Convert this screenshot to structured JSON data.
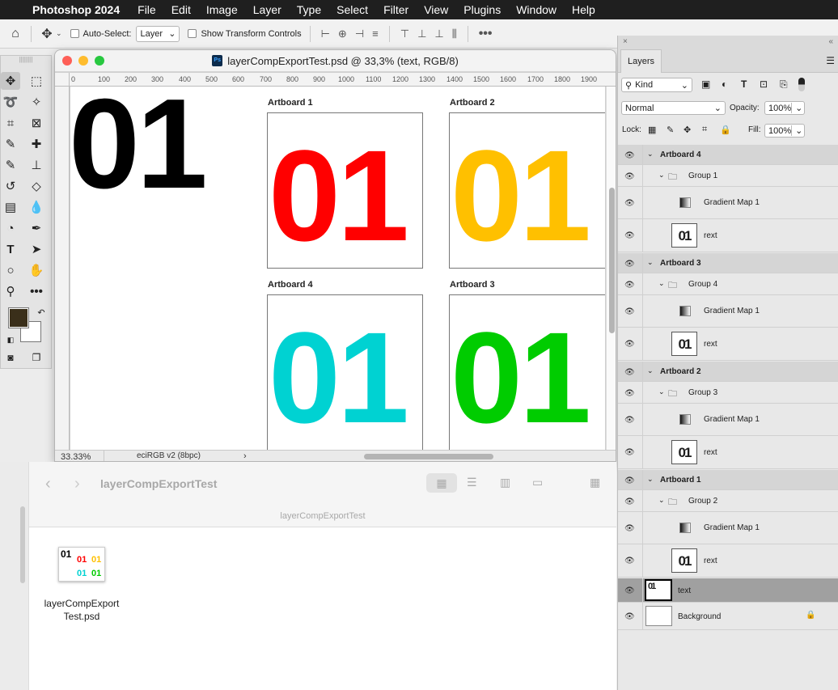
{
  "menubar": {
    "app": "Photoshop 2024",
    "items": [
      "File",
      "Edit",
      "Image",
      "Layer",
      "Type",
      "Select",
      "Filter",
      "View",
      "Plugins",
      "Window",
      "Help"
    ]
  },
  "options": {
    "auto_select_label": "Auto-Select:",
    "auto_select_value": "Layer",
    "show_transform_label": "Show Transform Controls"
  },
  "document": {
    "title": "layerCompExportTest.psd @ 33,3% (text, RGB/8)",
    "ps_badge": "Ps",
    "ruler_ticks": [
      "0",
      "100",
      "200",
      "300",
      "400",
      "500",
      "600",
      "700",
      "800",
      "900",
      "1000",
      "1100",
      "1200",
      "1300",
      "1400",
      "1500",
      "1600",
      "1700",
      "1800",
      "1900"
    ],
    "big_text": "01",
    "artboards": [
      {
        "label": "Artboard 1",
        "text": "01",
        "color": "#ff0000"
      },
      {
        "label": "Artboard 2",
        "text": "01",
        "color": "#ffc000"
      },
      {
        "label": "Artboard 4",
        "text": "01",
        "color": "#00d2d2"
      },
      {
        "label": "Artboard 3",
        "text": "01",
        "color": "#00cc00"
      }
    ],
    "zoom": "33.33%",
    "profile": "eciRGB v2 (8bpc)"
  },
  "finder": {
    "title": "layerCompExportTest",
    "path": "layerCompExportTest",
    "file_name_line1": "layerCompExport",
    "file_name_line2": "Test.psd",
    "thumb_text": "01"
  },
  "layers_panel": {
    "tab": "Layers",
    "kind": "Kind",
    "blend": "Normal",
    "opacity_label": "Opacity:",
    "opacity": "100%",
    "lock_label": "Lock:",
    "fill_label": "Fill:",
    "fill": "100%",
    "rows": [
      {
        "type": "artboard",
        "name": "Artboard 4"
      },
      {
        "type": "group",
        "name": "Group 1"
      },
      {
        "type": "gradient",
        "name": "Gradient Map 1"
      },
      {
        "type": "smart",
        "name": "rext",
        "thumb": "01"
      },
      {
        "type": "artboard",
        "name": "Artboard 3"
      },
      {
        "type": "group",
        "name": "Group 4"
      },
      {
        "type": "gradient",
        "name": "Gradient Map 1"
      },
      {
        "type": "smart",
        "name": "rext",
        "thumb": "01"
      },
      {
        "type": "artboard",
        "name": "Artboard 2"
      },
      {
        "type": "group",
        "name": "Group 3"
      },
      {
        "type": "gradient",
        "name": "Gradient Map 1"
      },
      {
        "type": "smart",
        "name": "rext",
        "thumb": "01"
      },
      {
        "type": "artboard",
        "name": "Artboard 1"
      },
      {
        "type": "group",
        "name": "Group 2"
      },
      {
        "type": "gradient",
        "name": "Gradient Map 1"
      },
      {
        "type": "smart",
        "name": "rext",
        "thumb": "01"
      },
      {
        "type": "text",
        "name": "text",
        "thumb": "01"
      },
      {
        "type": "background",
        "name": "Background"
      }
    ]
  }
}
